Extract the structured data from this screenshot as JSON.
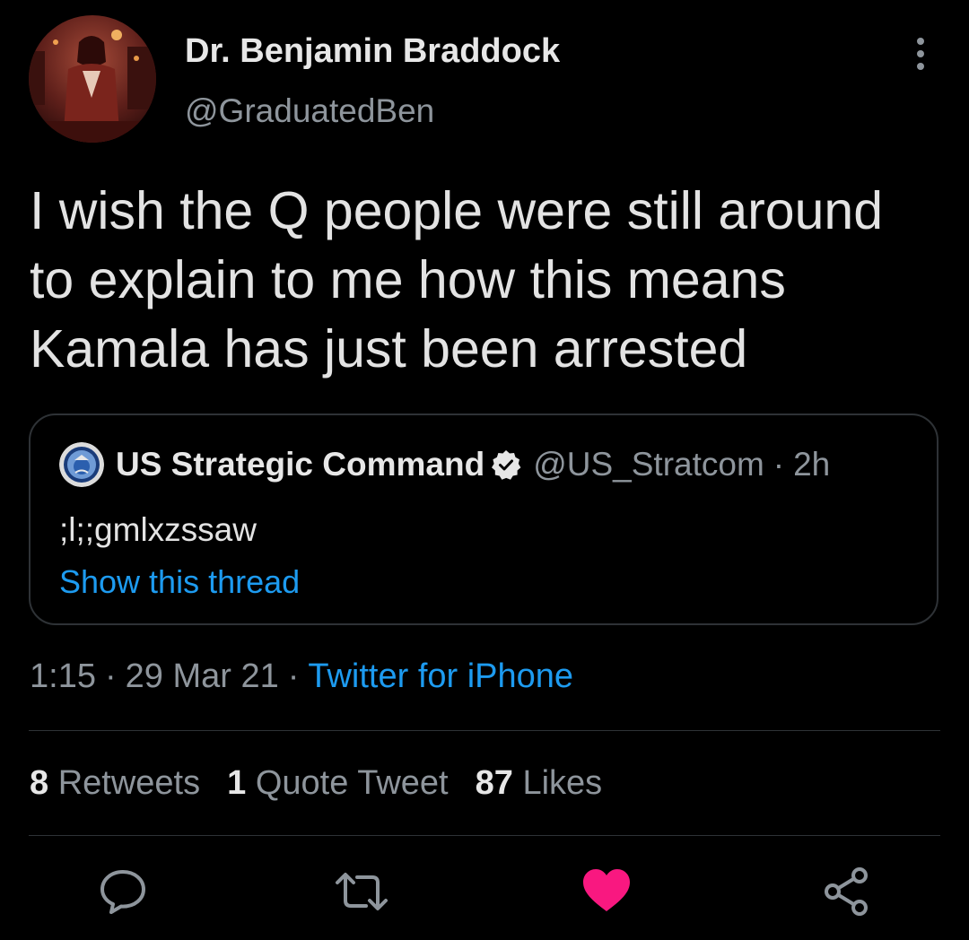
{
  "tweet": {
    "author": {
      "display_name": "Dr. Benjamin Braddock",
      "handle": "@GraduatedBen"
    },
    "text": "I wish the Q people were still around to explain to me how this means Kamala has just been arrested",
    "quoted_tweet": {
      "display_name": "US Strategic Command",
      "handle": "@US_Stratcom",
      "separator": "·",
      "time_ago": "2h",
      "text": ";l;;gmlxzssaw",
      "show_thread_label": "Show this thread"
    },
    "meta": {
      "time": "1:15",
      "separator": "·",
      "date": "29 Mar 21",
      "source": "Twitter for iPhone"
    },
    "stats": {
      "retweets_count": "8",
      "retweets_label": "Retweets",
      "quote_tweets_count": "1",
      "quote_tweets_label": "Quote Tweet",
      "likes_count": "87",
      "likes_label": "Likes"
    },
    "actions": {
      "reply_icon": "reply-icon",
      "retweet_icon": "retweet-icon",
      "like_icon": "heart-icon",
      "share_icon": "share-icon",
      "liked": true
    }
  },
  "colors": {
    "background": "#000000",
    "primary_text": "#e7e7e7",
    "secondary_text": "#8e959c",
    "link": "#1d9bf0",
    "like": "#f91880",
    "border": "#2e3236"
  }
}
